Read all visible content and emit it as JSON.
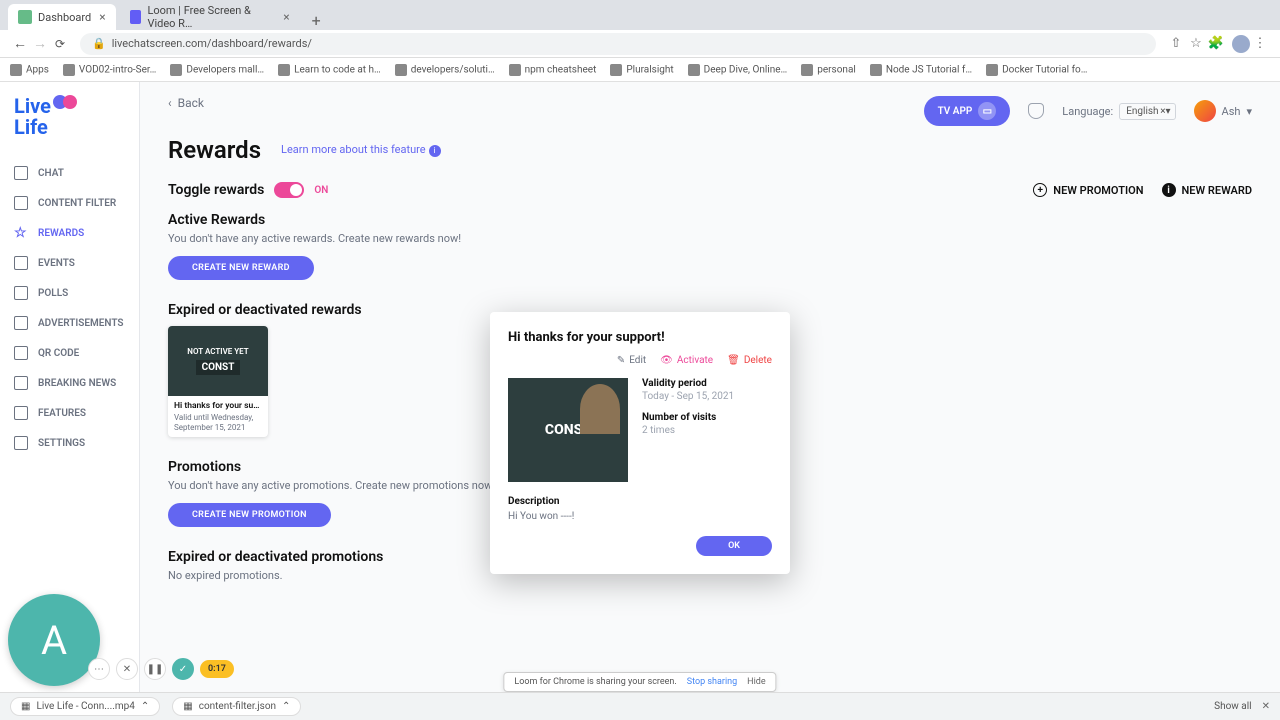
{
  "browser": {
    "tabs": [
      {
        "title": "Dashboard",
        "active": true
      },
      {
        "title": "Loom | Free Screen & Video R…",
        "active": false
      }
    ],
    "url": "livechatscreen.com/dashboard/rewards/"
  },
  "bookmarks": [
    "Apps",
    "VOD02-intro-Ser…",
    "Developers mall…",
    "Learn to code at h…",
    "developers/soluti…",
    "npm cheatsheet",
    "Pluralsight",
    "Deep Dive, Online…",
    "personal",
    "Node JS Tutorial f…",
    "Docker Tutorial fo…"
  ],
  "logo": {
    "line1": "Live",
    "line2": "Life"
  },
  "nav": [
    {
      "label": "CHAT",
      "icon": "chat-icon"
    },
    {
      "label": "CONTENT FILTER",
      "icon": "filter-icon"
    },
    {
      "label": "REWARDS",
      "icon": "star-icon",
      "active": true
    },
    {
      "label": "EVENTS",
      "icon": "calendar-icon"
    },
    {
      "label": "POLLS",
      "icon": "polls-icon"
    },
    {
      "label": "ADVERTISEMENTS",
      "icon": "ads-icon"
    },
    {
      "label": "QR CODE",
      "icon": "qr-icon"
    },
    {
      "label": "BREAKING NEWS",
      "icon": "news-icon"
    },
    {
      "label": "FEATURES",
      "icon": "features-icon"
    },
    {
      "label": "SETTINGS",
      "icon": "settings-icon"
    }
  ],
  "header": {
    "back": "Back",
    "tv_app": "TV APP",
    "language_label": "Language:",
    "language_value": "English",
    "user_name": "Ash"
  },
  "page": {
    "title": "Rewards",
    "learn_more": "Learn more about this feature",
    "toggle_label": "Toggle rewards",
    "toggle_state": "ON",
    "new_promo": "NEW PROMOTION",
    "new_reward": "NEW REWARD"
  },
  "sections": {
    "active_rewards": {
      "title": "Active Rewards",
      "desc": "You don't have any active rewards. Create new rewards now!",
      "button": "CREATE NEW REWARD"
    },
    "expired_rewards": {
      "title": "Expired or deactivated rewards",
      "card": {
        "overlay": "NOT ACTIVE YET",
        "const": "CONST",
        "title": "Hi thanks for your supp…",
        "subtitle": "Valid until Wednesday, September 15, 2021"
      }
    },
    "promotions": {
      "title": "Promotions",
      "desc": "You don't have any active promotions. Create new promotions now!",
      "button": "CREATE NEW PROMOTION"
    },
    "expired_promos": {
      "title": "Expired or deactivated promotions",
      "desc": "No expired promotions."
    }
  },
  "modal": {
    "title": "Hi thanks for your support!",
    "edit": "Edit",
    "activate": "Activate",
    "delete": "Delete",
    "img_text": "CONST",
    "validity_label": "Validity period",
    "validity_value": "Today - Sep 15, 2021",
    "visits_label": "Number of visits",
    "visits_value": "2 times",
    "desc_label": "Description",
    "desc_value": "Hi You won ----!",
    "ok": "OK"
  },
  "loom": {
    "avatar_letter": "A",
    "timer": "0:17"
  },
  "share_banner": {
    "text": "Loom for Chrome is sharing your screen.",
    "stop": "Stop sharing",
    "hide": "Hide"
  },
  "downloads": {
    "item1": "Live Life - Conn....mp4",
    "item2": "content-filter.json",
    "show_all": "Show all"
  }
}
